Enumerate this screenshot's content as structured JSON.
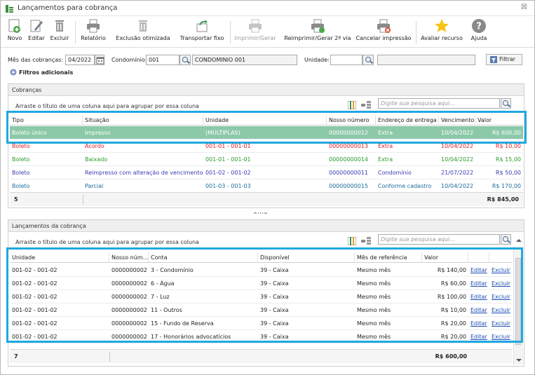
{
  "window": {
    "title": "Lançamentos para cobrança",
    "close_glyph": "☒"
  },
  "toolbar": {
    "items": [
      {
        "label": "Novo",
        "icon": "new-icon"
      },
      {
        "label": "Editar",
        "icon": "edit-icon"
      },
      {
        "label": "Excluir",
        "icon": "trash-icon"
      },
      {
        "label": "Relatório",
        "icon": "printer-icon"
      },
      {
        "label": "Exclusão otimizada",
        "icon": "trash-icon"
      },
      {
        "label": "Transportar fixo",
        "icon": "transport-icon"
      },
      {
        "label": "Imprimir/Gerar",
        "icon": "printer-icon",
        "disabled": true
      },
      {
        "label": "Reimprimir/Gerar 2ª via",
        "icon": "printer-icon"
      },
      {
        "label": "Cancelar impressão",
        "icon": "printer-cancel-icon"
      },
      {
        "label": "Avaliar recurso",
        "icon": "star-icon"
      },
      {
        "label": "Ajuda",
        "icon": "help-icon"
      }
    ]
  },
  "filters": {
    "mes_label": "Mês das cobranças:",
    "mes_value": "04/2022",
    "condominio_label": "Condomínio:",
    "condominio_code": "001",
    "condominio_name": "CONDOMINIO 001",
    "unidade_label": "Unidade:",
    "unidade_value": "",
    "filtrar_label": "Filtrar",
    "filtros_adicionais": "Filtros adicionais"
  },
  "cobrancas": {
    "title": "Cobranças",
    "group_hint": "Arraste o título de uma coluna aqui para agrupar por essa coluna",
    "search_placeholder": "Digite sua pesquisa aqui...",
    "columns": [
      "Tipo",
      "Situação",
      "Unidade",
      "Nosso número",
      "Endereço de entrega",
      "Vencimento",
      "Valor"
    ],
    "rows": [
      {
        "tipo": "Boleto único",
        "situacao": "Impresso",
        "unidade": "(MÚLTIPLAS)",
        "nosso_numero": "00000000012",
        "endereco": "Extra",
        "vencimento": "10/04/2022",
        "valor": "R$ 600,00",
        "style": "sel"
      },
      {
        "tipo": "Boleto",
        "situacao": "Acordo",
        "unidade": "001-01 - 001-01",
        "nosso_numero": "00000000013",
        "endereco": "Extra",
        "vencimento": "10/04/2022",
        "valor": "R$ 10,00",
        "style": "c-red"
      },
      {
        "tipo": "Boleto",
        "situacao": "Baixado",
        "unidade": "001-01 - 001-01",
        "nosso_numero": "00000000014",
        "endereco": "Extra",
        "vencimento": "10/04/2022",
        "valor": "R$ 15,00",
        "style": "c-green"
      },
      {
        "tipo": "Boleto",
        "situacao": "Reimpresso com alteração de vencimento",
        "unidade": "001-02 - 001-02",
        "nosso_numero": "00000000011",
        "endereco": "Condomínio",
        "vencimento": "21/07/2022",
        "valor": "R$ 50,00",
        "style": "c-blue"
      },
      {
        "tipo": "Boleto",
        "situacao": "Parcial",
        "unidade": "001-03 - 001-03",
        "nosso_numero": "00000000015",
        "endereco": "Conforme cadastro",
        "vencimento": "10/04/2022",
        "valor": "R$ 170,00",
        "style": "c-teal"
      }
    ],
    "footer_count": "5",
    "footer_total": "R$ 845,00"
  },
  "lancamentos": {
    "title": "Lançamentos da cobrança",
    "group_hint": "Arraste o título de uma coluna aqui para agrupar por essa coluna",
    "search_placeholder": "Digite sua pesquisa aqui...",
    "columns": [
      "Unidade",
      "Nosso núm...",
      "Conta",
      "Disponível",
      "Mês de referência",
      "Valor",
      "",
      ""
    ],
    "rows": [
      {
        "unidade": "001-02 - 001-02",
        "nosso": "0000000002",
        "conta": "3 - Condomínio",
        "disponivel": "39 - Caixa",
        "mes": "Mesmo mês",
        "valor": "R$ 140,00",
        "editar": "Editar",
        "excluir": "Excluir"
      },
      {
        "unidade": "001-02 - 001-02",
        "nosso": "0000000002",
        "conta": "6 - Água",
        "disponivel": "39 - Caixa",
        "mes": "Mesmo mês",
        "valor": "R$ 60,00",
        "editar": "Editar",
        "excluir": "Excluir"
      },
      {
        "unidade": "001-02 - 001-02",
        "nosso": "0000000002",
        "conta": "7 - Luz",
        "disponivel": "39 - Caixa",
        "mes": "Mesmo mês",
        "valor": "R$ 100,00",
        "editar": "Editar",
        "excluir": "Excluir"
      },
      {
        "unidade": "001-02 - 001-02",
        "nosso": "0000000002",
        "conta": "11 - Outros",
        "disponivel": "39 - Caixa",
        "mes": "Mesmo mês",
        "valor": "R$ 10,00",
        "editar": "Editar",
        "excluir": "Excluir"
      },
      {
        "unidade": "001-02 - 001-02",
        "nosso": "0000000002",
        "conta": "15 - Fundo  de Reserva",
        "disponivel": "39 - Caixa",
        "mes": "Mesmo mês",
        "valor": "R$ 20,00",
        "editar": "Editar",
        "excluir": "Excluir"
      },
      {
        "unidade": "001-02 - 001-02",
        "nosso": "0000000002",
        "conta": "17 - Honorários advocatícios",
        "disponivel": "39 - Caixa",
        "mes": "Mesmo mês",
        "valor": "R$ 20,00",
        "editar": "Editar",
        "excluir": "Excluir"
      }
    ],
    "footer_count": "7",
    "footer_total": "R$ 600,00"
  },
  "colors": {
    "highlight": "#20a8e0",
    "selected_row": "#8cc9a8",
    "link": "#1a4bb4"
  }
}
